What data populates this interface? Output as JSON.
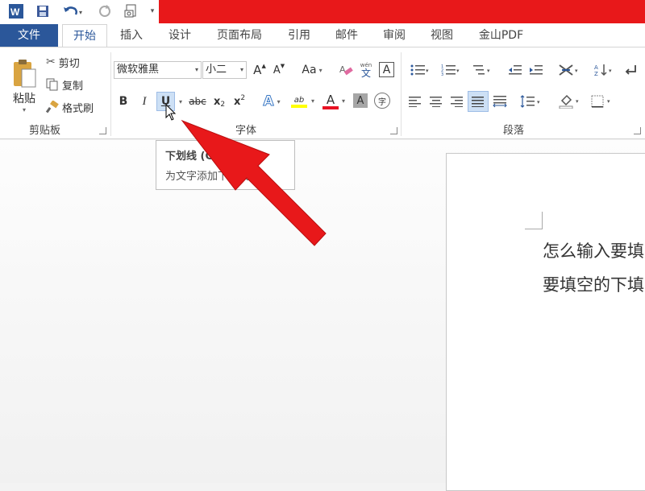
{
  "qat": {
    "word_icon": "word-icon",
    "save_icon": "save-icon",
    "undo_icon": "undo-icon",
    "redo_icon": "redo-icon",
    "print_preview_icon": "print-preview-icon",
    "customize_icon": "customize-icon",
    "title_bar_color": "#e8181a"
  },
  "tabs": [
    "文件",
    "开始",
    "插入",
    "设计",
    "页面布局",
    "引用",
    "邮件",
    "审阅",
    "视图",
    "金山PDF"
  ],
  "active_tab": "开始",
  "clipboard": {
    "paste_label": "粘贴",
    "cut_label": "剪切",
    "copy_label": "复制",
    "format_painter_label": "格式刷",
    "group_label": "剪贴板"
  },
  "font": {
    "font_name": "微软雅黑",
    "font_size": "小二",
    "grow_font": "A",
    "shrink_font": "A",
    "change_case": "Aa",
    "phonetic_top": "wén",
    "phonetic_bottom": "文",
    "border_char": "A",
    "bold": "B",
    "italic": "I",
    "underline": "U",
    "strikethrough": "abc",
    "subscript_base": "x",
    "subscript_sub": "2",
    "superscript_base": "x",
    "superscript_sup": "2",
    "text_effects": "A",
    "highlight": "ab",
    "font_color": "A",
    "char_shading": "A",
    "enclose": "字",
    "group_label": "字体",
    "highlight_color": "#ffff00",
    "font_color_bar": "#e81123"
  },
  "paragraph": {
    "group_label": "段落"
  },
  "tooltip": {
    "title": "下划线 (Ctrl+U)",
    "description": "为文字添加下划线。"
  },
  "document": {
    "line1": "怎么输入要填",
    "line2": "要填空的下填"
  },
  "annotation": {
    "arrow_color": "#e8181a"
  }
}
